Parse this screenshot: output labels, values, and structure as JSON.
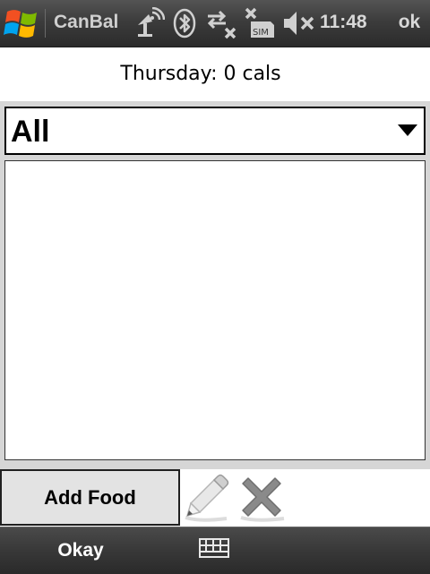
{
  "title_bar": {
    "app_title": "CanBal",
    "clock": "11:48",
    "ok_label": "ok",
    "icons": [
      "windows-start-icon",
      "network-antenna-icon",
      "bluetooth-icon",
      "data-connection-off-icon",
      "no-sim-icon",
      "volume-muted-icon"
    ]
  },
  "summary": {
    "text": "Thursday: 0 cals"
  },
  "filter": {
    "selected": "All"
  },
  "food_list": {
    "items": []
  },
  "actions": {
    "add_food_label": "Add Food",
    "edit_icon": "pencil-icon",
    "delete_icon": "delete-x-icon"
  },
  "softkeys": {
    "left_label": "Okay",
    "input_icon": "keyboard-icon"
  },
  "colors": {
    "bar_background": "#383838",
    "panel_background": "#d6d6d6",
    "button_background": "#e3e3e3"
  }
}
